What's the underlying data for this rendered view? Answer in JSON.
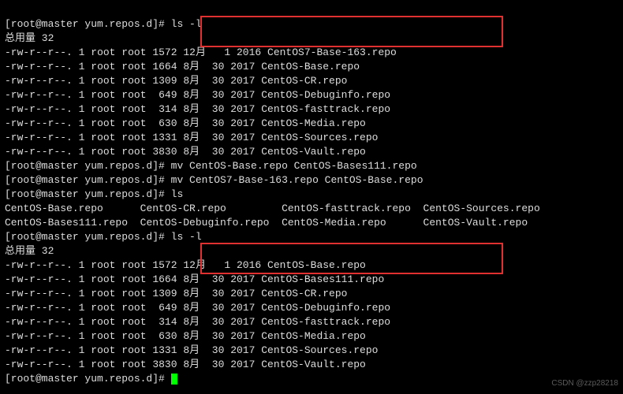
{
  "prompt": "[root@master yum.repos.d]# ",
  "cmd_ls_l": "ls -l",
  "total_line": "总用量 32",
  "ls1": [
    {
      "perm": "-rw-r--r--.",
      "ln": "1",
      "own": "root",
      "grp": "root",
      "size": "1572",
      "mon": "12月",
      "day": " 1",
      "year": "2016",
      "name": "CentOS7-Base-163.repo"
    },
    {
      "perm": "-rw-r--r--.",
      "ln": "1",
      "own": "root",
      "grp": "root",
      "size": "1664",
      "mon": "8月",
      "day": "30",
      "year": "2017",
      "name": "CentOS-Base.repo"
    },
    {
      "perm": "-rw-r--r--.",
      "ln": "1",
      "own": "root",
      "grp": "root",
      "size": "1309",
      "mon": "8月",
      "day": "30",
      "year": "2017",
      "name": "CentOS-CR.repo"
    },
    {
      "perm": "-rw-r--r--.",
      "ln": "1",
      "own": "root",
      "grp": "root",
      "size": " 649",
      "mon": "8月",
      "day": "30",
      "year": "2017",
      "name": "CentOS-Debuginfo.repo"
    },
    {
      "perm": "-rw-r--r--.",
      "ln": "1",
      "own": "root",
      "grp": "root",
      "size": " 314",
      "mon": "8月",
      "day": "30",
      "year": "2017",
      "name": "CentOS-fasttrack.repo"
    },
    {
      "perm": "-rw-r--r--.",
      "ln": "1",
      "own": "root",
      "grp": "root",
      "size": " 630",
      "mon": "8月",
      "day": "30",
      "year": "2017",
      "name": "CentOS-Media.repo"
    },
    {
      "perm": "-rw-r--r--.",
      "ln": "1",
      "own": "root",
      "grp": "root",
      "size": "1331",
      "mon": "8月",
      "day": "30",
      "year": "2017",
      "name": "CentOS-Sources.repo"
    },
    {
      "perm": "-rw-r--r--.",
      "ln": "1",
      "own": "root",
      "grp": "root",
      "size": "3830",
      "mon": "8月",
      "day": "30",
      "year": "2017",
      "name": "CentOS-Vault.repo"
    }
  ],
  "cmd_mv1": "mv CentOS-Base.repo CentOS-Bases111.repo",
  "cmd_mv2": "mv CentOS7-Base-163.repo CentOS-Base.repo",
  "cmd_ls": "ls",
  "ls_cols_row1": {
    "c1": "CentOS-Base.repo",
    "c2": "CentOS-CR.repo",
    "c3": "CentOS-fasttrack.repo",
    "c4": "CentOS-Sources.repo"
  },
  "ls_cols_row2": {
    "c1": "CentOS-Bases111.repo",
    "c2": "CentOS-Debuginfo.repo",
    "c3": "CentOS-Media.repo",
    "c4": "CentOS-Vault.repo"
  },
  "ls2": [
    {
      "perm": "-rw-r--r--.",
      "ln": "1",
      "own": "root",
      "grp": "root",
      "size": "1572",
      "mon": "12月",
      "day": " 1",
      "year": "2016",
      "name": "CentOS-Base.repo"
    },
    {
      "perm": "-rw-r--r--.",
      "ln": "1",
      "own": "root",
      "grp": "root",
      "size": "1664",
      "mon": "8月",
      "day": "30",
      "year": "2017",
      "name": "CentOS-Bases111.repo"
    },
    {
      "perm": "-rw-r--r--.",
      "ln": "1",
      "own": "root",
      "grp": "root",
      "size": "1309",
      "mon": "8月",
      "day": "30",
      "year": "2017",
      "name": "CentOS-CR.repo"
    },
    {
      "perm": "-rw-r--r--.",
      "ln": "1",
      "own": "root",
      "grp": "root",
      "size": " 649",
      "mon": "8月",
      "day": "30",
      "year": "2017",
      "name": "CentOS-Debuginfo.repo"
    },
    {
      "perm": "-rw-r--r--.",
      "ln": "1",
      "own": "root",
      "grp": "root",
      "size": " 314",
      "mon": "8月",
      "day": "30",
      "year": "2017",
      "name": "CentOS-fasttrack.repo"
    },
    {
      "perm": "-rw-r--r--.",
      "ln": "1",
      "own": "root",
      "grp": "root",
      "size": " 630",
      "mon": "8月",
      "day": "30",
      "year": "2017",
      "name": "CentOS-Media.repo"
    },
    {
      "perm": "-rw-r--r--.",
      "ln": "1",
      "own": "root",
      "grp": "root",
      "size": "1331",
      "mon": "8月",
      "day": "30",
      "year": "2017",
      "name": "CentOS-Sources.repo"
    },
    {
      "perm": "-rw-r--r--.",
      "ln": "1",
      "own": "root",
      "grp": "root",
      "size": "3830",
      "mon": "8月",
      "day": "30",
      "year": "2017",
      "name": "CentOS-Vault.repo"
    }
  ],
  "watermark": "CSDN @zzp28218"
}
